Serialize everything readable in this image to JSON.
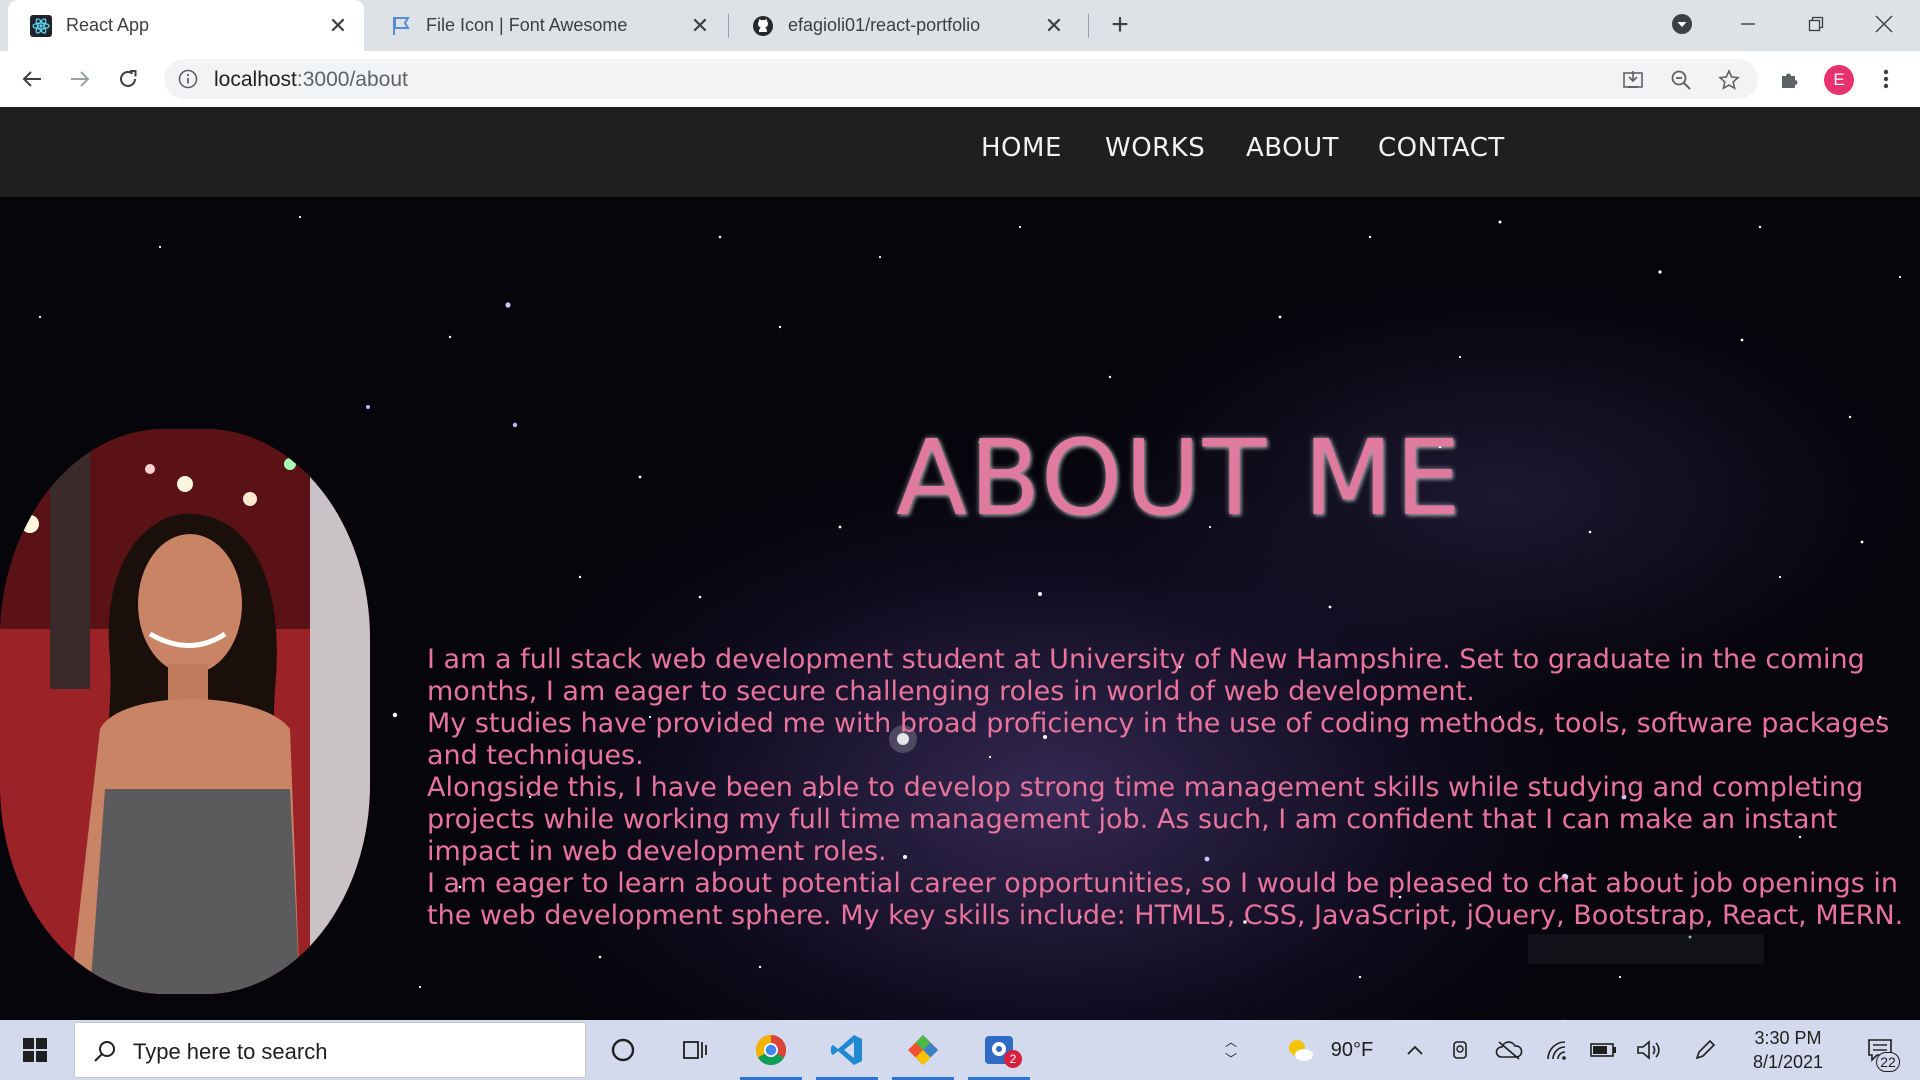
{
  "browser": {
    "tabs": [
      {
        "title": "React App",
        "favicon": "react-icon",
        "active": true
      },
      {
        "title": "File Icon | Font Awesome",
        "favicon": "flag-icon",
        "active": false
      },
      {
        "title": "efagioli01/react-portfolio",
        "favicon": "github-icon",
        "active": false
      }
    ],
    "url_host": "localhost",
    "url_path": ":3000/about",
    "profile_initial": "E"
  },
  "site": {
    "nav": [
      "HOME",
      "WORKS",
      "ABOUT",
      "CONTACT"
    ],
    "title": "ABOUT ME",
    "bio": [
      "I am a full stack web development student at University of New Hampshire. Set to graduate in the coming months, I am eager to secure challenging roles in world of web development.",
      "My studies have provided me with broad proficiency in the use of coding methods, tools, software packages and techniques.",
      "Alongside this, I have been able to develop strong time management skills while studying and completing projects while working my full time management job. As such, I am confident that I can make an instant impact in web development roles.",
      "I am eager to learn about potential career opportunities, so I would be pleased to chat about job openings in the web development sphere. My key skills include: HTML5, CSS, JavaScript, jQuery, Bootstrap, React, MERN."
    ],
    "colors": {
      "accent": "#e07a9e",
      "nav_bg": "#1f1f1f"
    }
  },
  "taskbar": {
    "search_placeholder": "Type here to search",
    "weather": "90°F",
    "time": "3:30 PM",
    "date": "8/1/2021",
    "notification_count": "22",
    "app_badge": "2"
  }
}
